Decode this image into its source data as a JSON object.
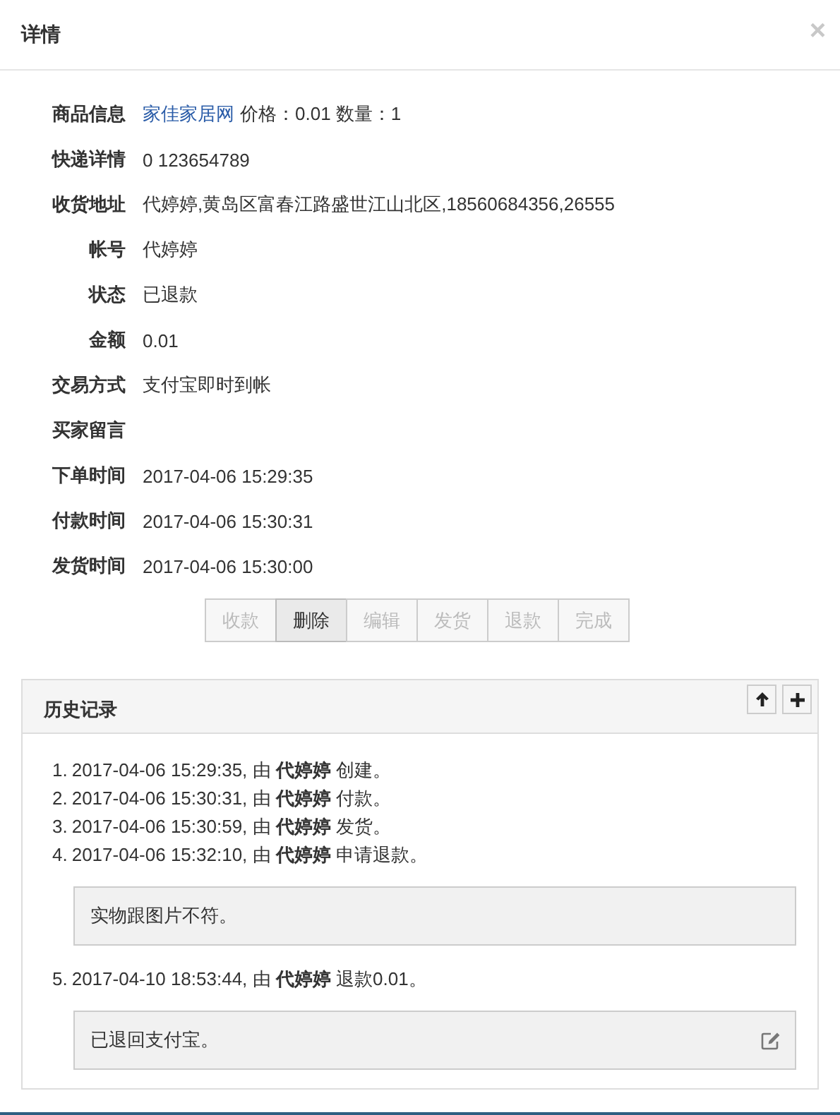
{
  "dialog": {
    "title": "详情",
    "close": "×"
  },
  "fields": [
    {
      "label": "商品信息",
      "link": "家佳家居网",
      "value": "价格：0.01 数量：1"
    },
    {
      "label": "快递详情",
      "value": "0 123654789"
    },
    {
      "label": "收货地址",
      "value": "代婷婷,黄岛区富春江路盛世江山北区,18560684356,26555"
    },
    {
      "label": "帐号",
      "value": "代婷婷"
    },
    {
      "label": "状态",
      "value": "已退款"
    },
    {
      "label": "金额",
      "value": "0.01"
    },
    {
      "label": "交易方式",
      "value": "支付宝即时到帐"
    },
    {
      "label": "买家留言"
    },
    {
      "label": "下单时间",
      "value": "2017-04-06 15:29:35"
    },
    {
      "label": "付款时间",
      "value": "2017-04-06 15:30:31"
    },
    {
      "label": "发货时间",
      "value": "2017-04-06 15:30:00"
    }
  ],
  "actions": [
    {
      "label": "收款",
      "disabled": true
    },
    {
      "label": "删除",
      "disabled": false
    },
    {
      "label": "编辑",
      "disabled": true
    },
    {
      "label": "发货",
      "disabled": true
    },
    {
      "label": "退款",
      "disabled": true
    },
    {
      "label": "完成",
      "disabled": true
    }
  ],
  "history": {
    "title": "历史记录",
    "entries": [
      {
        "number": "1.",
        "text": "2017-04-06 15:29:35, 由 **代婷婷** 创建。"
      },
      {
        "number": "2.",
        "text": "2017-04-06 15:30:31, 由 **代婷婷** 付款。"
      },
      {
        "number": "3.",
        "text": "2017-04-06 15:30:59, 由 **代婷婷** 发货。"
      },
      {
        "number": "4.",
        "text": "2017-04-06 15:32:10, 由 **代婷婷** 申请退款。",
        "note": {
          "text": "实物跟图片不符。",
          "editable": false
        }
      },
      {
        "number": "5.",
        "text": "2017-04-10 18:53:44, 由 **代婷婷** 退款0.01。",
        "note": {
          "text": "已退回支付宝。",
          "editable": true
        }
      }
    ]
  }
}
